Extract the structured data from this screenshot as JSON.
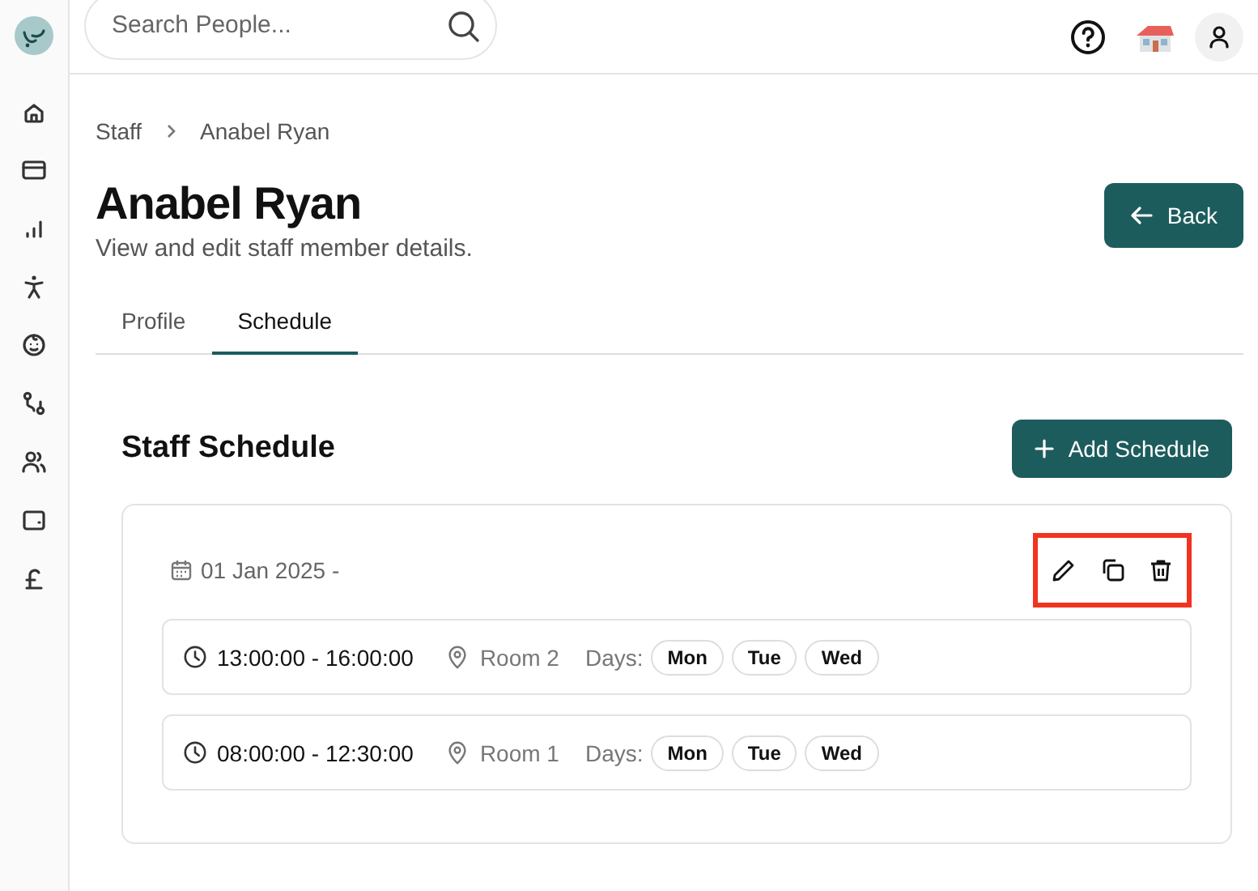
{
  "search": {
    "placeholder": "Search People..."
  },
  "breadcrumb": [
    "Staff",
    "Anabel Ryan"
  ],
  "header": {
    "title": "Anabel Ryan",
    "subtitle": "View and edit staff member details.",
    "back_button": "Back"
  },
  "tabs": [
    {
      "label": "Profile",
      "selected": false
    },
    {
      "label": "Schedule",
      "selected": true
    }
  ],
  "schedule": {
    "title": "Staff Schedule",
    "add_button": "Add Schedule",
    "entries": [
      {
        "date": "01 Jan 2025 -",
        "actions_highlighted": true,
        "slots": [
          {
            "time": "13:00:00 - 16:00:00",
            "room": "Room 2",
            "days_label": "Days:",
            "days": [
              "Mon",
              "Tue",
              "Wed"
            ]
          },
          {
            "time": "08:00:00 - 12:30:00",
            "room": "Room 1",
            "days_label": "Days:",
            "days": [
              "Mon",
              "Tue",
              "Wed"
            ]
          }
        ]
      }
    ]
  }
}
